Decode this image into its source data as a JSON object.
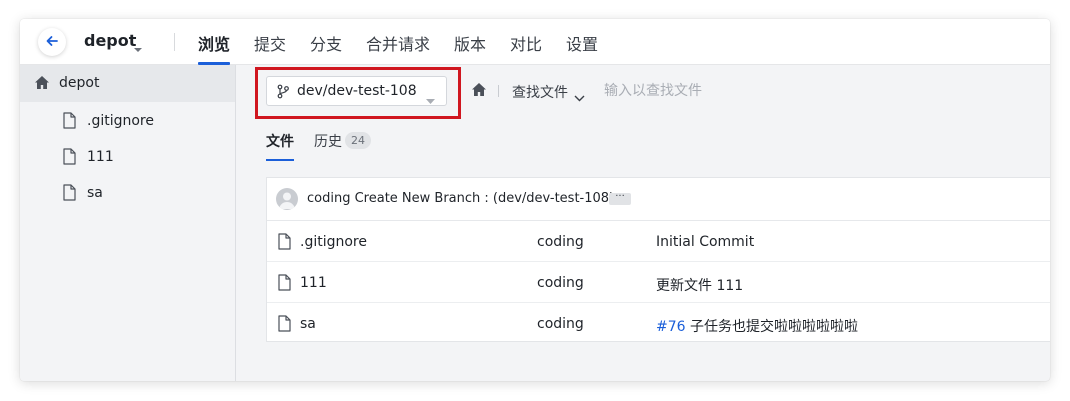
{
  "header": {
    "repo_name": "depot",
    "tabs": [
      {
        "label": "浏览",
        "active": true
      },
      {
        "label": "提交"
      },
      {
        "label": "分支"
      },
      {
        "label": "合并请求"
      },
      {
        "label": "版本"
      },
      {
        "label": "对比"
      },
      {
        "label": "设置"
      }
    ]
  },
  "sidebar": {
    "root_label": "depot",
    "files": [
      ".gitignore",
      "111",
      "sa"
    ]
  },
  "toolbar": {
    "branch": "dev/dev-test-108",
    "find_file_label": "查找文件",
    "find_placeholder": "输入以查找文件"
  },
  "subtabs": {
    "files_label": "文件",
    "history_label": "历史",
    "history_count": "24"
  },
  "commit": {
    "text": "coding Create New Branch : (dev/dev-test-108)",
    "more": "···"
  },
  "rows": [
    {
      "name": ".gitignore",
      "author": "coding",
      "message": "Initial Commit",
      "issue": ""
    },
    {
      "name": "111",
      "author": "coding",
      "message": "更新文件 111",
      "issue": ""
    },
    {
      "name": "sa",
      "author": "coding",
      "message": "子任务也提交啦啦啦啦啦啦",
      "issue": "#76"
    }
  ],
  "colors": {
    "accent": "#1b5fd9",
    "highlight_border": "#d0161f"
  },
  "icons": {
    "back": "arrow-left-icon",
    "home": "home-icon",
    "branch": "git-branch-icon",
    "file": "file-icon"
  }
}
